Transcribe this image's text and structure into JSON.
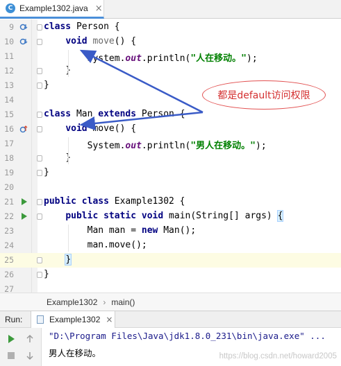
{
  "tab": {
    "title": "Example1302.java",
    "icon": "java-class-icon",
    "close": "×"
  },
  "editor": {
    "lines": [
      {
        "num": "9"
      },
      {
        "num": "10"
      },
      {
        "num": "11"
      },
      {
        "num": "12"
      },
      {
        "num": "13"
      },
      {
        "num": "14"
      },
      {
        "num": "15"
      },
      {
        "num": "16"
      },
      {
        "num": "17"
      },
      {
        "num": "18"
      },
      {
        "num": "19"
      },
      {
        "num": "20"
      },
      {
        "num": "21"
      },
      {
        "num": "22"
      },
      {
        "num": "23"
      },
      {
        "num": "24"
      },
      {
        "num": "25"
      },
      {
        "num": "26"
      },
      {
        "num": "27"
      }
    ],
    "code": {
      "l9_kw": "class",
      "l9_rest": " Person {",
      "l10_kw": "void",
      "l10_name": " move",
      "l10_rest": "() {",
      "l11_a": "System.",
      "l11_out": "out",
      "l11_b": ".println(",
      "l11_str": "\"人在移动。\"",
      "l11_c": ");",
      "l12": "}",
      "l13": "}",
      "l15_kw1": "class",
      "l15_mid": " Man ",
      "l15_kw2": "extends",
      "l15_rest": " Person {",
      "l16_kw": "void",
      "l16_rest": " move() {",
      "l17_a": "System.",
      "l17_out": "out",
      "l17_b": ".println(",
      "l17_str": "\"男人在移动。\"",
      "l17_c": ");",
      "l18": "}",
      "l19": "}",
      "l21_kw1": "public",
      "l21_kw2": "class",
      "l21_rest": " Example1302 {",
      "l22_kw1": "public",
      "l22_kw2": "static",
      "l22_kw3": "void",
      "l22_rest": " main(String[] args) ",
      "l22_brace": "{",
      "l23_a": "Man man = ",
      "l23_kw": "new",
      "l23_b": " Man();",
      "l24": "man.move();",
      "l25": "}",
      "l26": "}"
    },
    "callout": "都是default访问权限"
  },
  "breadcrumb": {
    "items": [
      "Example1302",
      "main()"
    ],
    "sep": "›"
  },
  "run": {
    "label": "Run:",
    "tab": "Example1302",
    "close": "×",
    "command": "\"D:\\Program Files\\Java\\jdk1.8.0_231\\bin\\java.exe\" ...",
    "output": "男人在移动。",
    "watermark": "https://blog.csdn.net/howard2005"
  },
  "colors": {
    "keyword": "#000080",
    "string": "#008000",
    "static_field": "#660e7a",
    "callout": "#d43030",
    "arrow": "#3a5bc7"
  }
}
